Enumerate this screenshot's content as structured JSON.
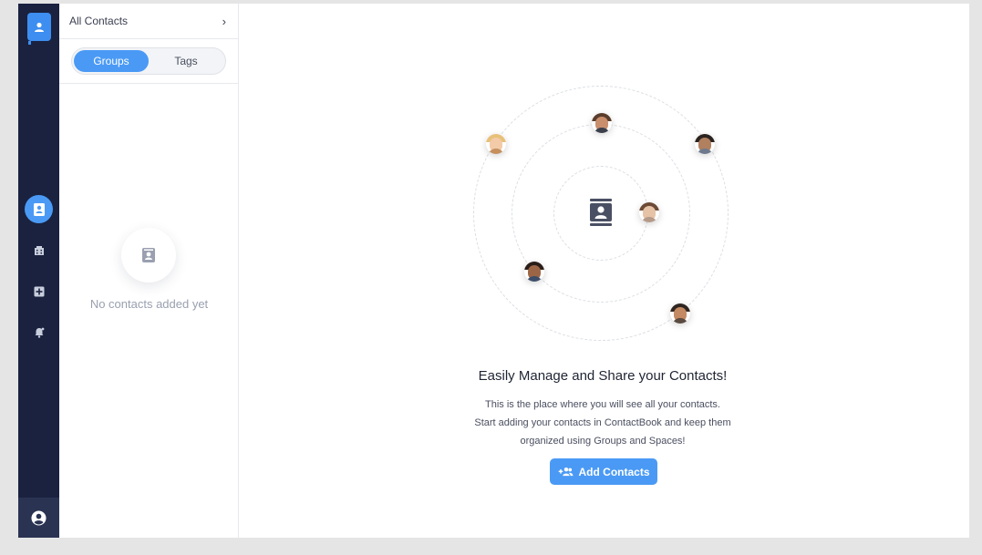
{
  "nav": {
    "items": [
      {
        "name": "contacts",
        "icon": "contact-book-icon",
        "active": true
      },
      {
        "name": "organizations",
        "icon": "building-icon",
        "active": false
      },
      {
        "name": "add-group",
        "icon": "add-box-icon",
        "active": false
      },
      {
        "name": "notifications",
        "icon": "bell-icon",
        "active": false
      }
    ],
    "profile_icon": "user-circle-icon"
  },
  "list": {
    "header": "All Contacts",
    "tabs": [
      {
        "label": "Groups",
        "selected": true
      },
      {
        "label": "Tags",
        "selected": false
      }
    ],
    "empty_text": "No contacts added yet"
  },
  "main": {
    "headline": "Easily Manage and Share your Contacts!",
    "description_lines": [
      "This is the place where you will see all your contacts.",
      "Start adding your contacts in ContactBook and keep them",
      "organized using Groups and Spaces!"
    ],
    "add_button_label": "Add Contacts"
  },
  "colors": {
    "accent": "#4a9af5",
    "nav_bg": "#1a2240"
  }
}
